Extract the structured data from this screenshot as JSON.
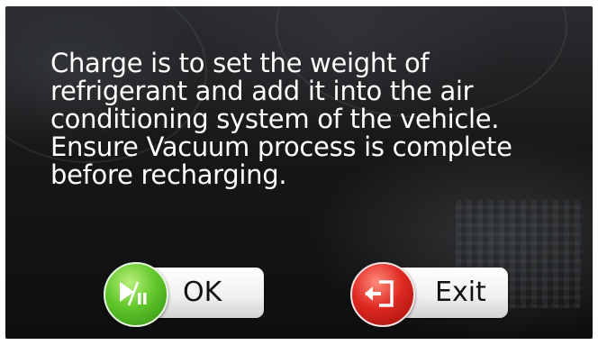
{
  "message": {
    "line1": "Charge is to set the weight of",
    "line2": "refrigerant and add it into the air",
    "line3": "conditioning system of the vehicle.",
    "line4": "Ensure Vacuum process is complete",
    "line5": "before recharging."
  },
  "buttons": {
    "ok": {
      "label": "OK",
      "icon": "play-pause-icon",
      "color": "#4caf22"
    },
    "exit": {
      "label": "Exit",
      "icon": "exit-door-icon",
      "color": "#d4241c"
    }
  }
}
